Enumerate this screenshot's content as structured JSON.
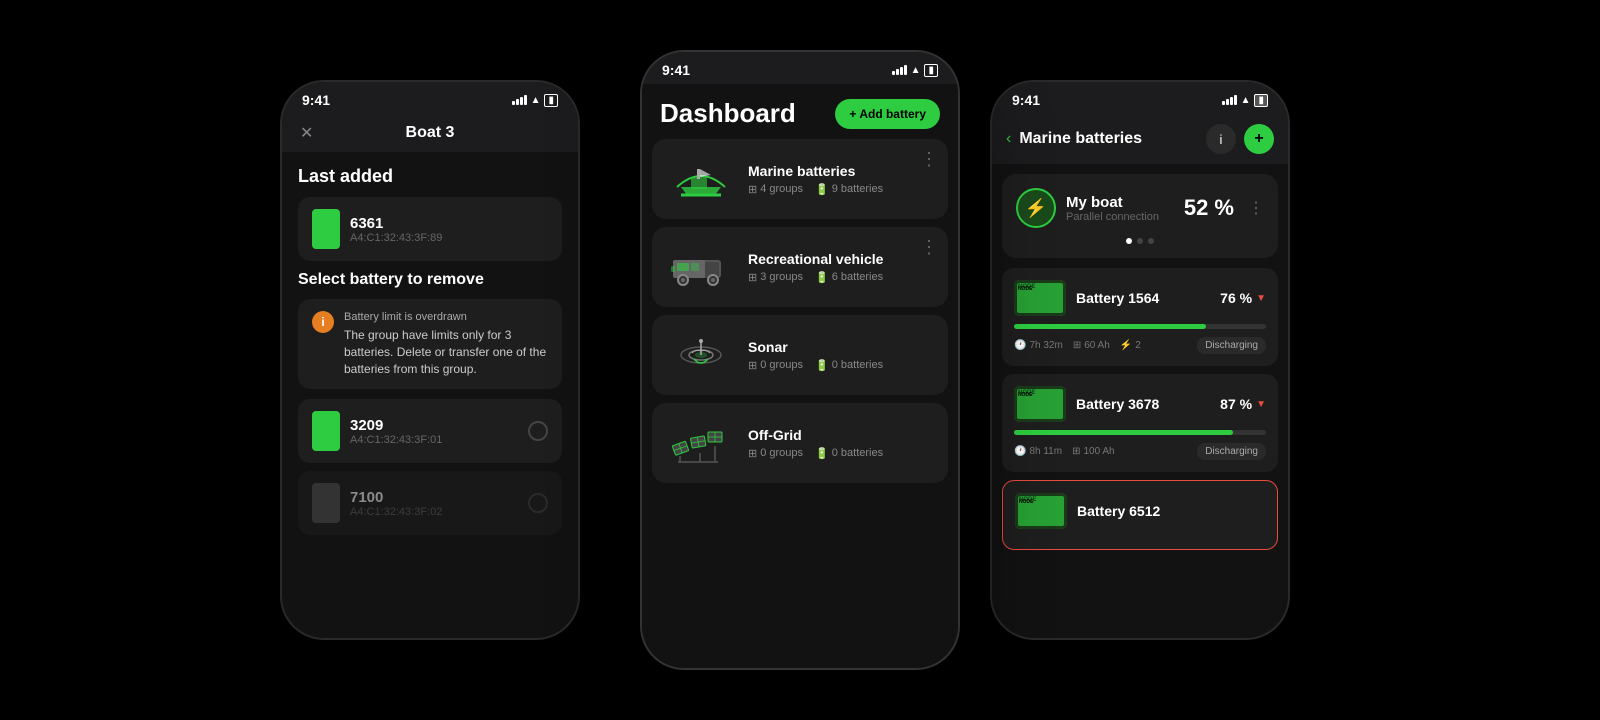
{
  "center_phone": {
    "status_time": "9:41",
    "title": "Dashboard",
    "add_button": "+ Add battery",
    "cards": [
      {
        "id": "marine",
        "title": "Marine batteries",
        "groups": "4 groups",
        "batteries": "9 batteries",
        "icon": "boat"
      },
      {
        "id": "rv",
        "title": "Recreational vehicle",
        "groups": "3 groups",
        "batteries": "6 batteries",
        "icon": "rv"
      },
      {
        "id": "sonar",
        "title": "Sonar",
        "groups": "0 groups",
        "batteries": "0 batteries",
        "icon": "sonar"
      },
      {
        "id": "offgrid",
        "title": "Off-Grid",
        "groups": "0 groups",
        "batteries": "0 batteries",
        "icon": "offgrid"
      }
    ]
  },
  "left_phone": {
    "status_time": "9:41",
    "header_title": "Boat 3",
    "section_last_added": "Last added",
    "last_battery": {
      "name": "6361",
      "mac": "A4:C1:32:43:3F:89"
    },
    "section_select": "Select battery to remove",
    "warning_title": "Battery limit is overdrawn",
    "warning_body": "The group have limits only for 3 batteries. Delete or transfer one of the batteries from this group.",
    "batteries": [
      {
        "name": "3209",
        "mac": "A4:C1:32:43:3F:01"
      },
      {
        "name": "7100",
        "mac": "A4:C1:32:43:3F:02"
      }
    ]
  },
  "right_phone": {
    "status_time": "9:41",
    "header_title": "Marine batteries",
    "group_card": {
      "name": "My boat",
      "sub": "Parallel connection",
      "percent": "52 %"
    },
    "batteries": [
      {
        "name": "Battery 1564",
        "percent": "76 %",
        "time": "7h 32m",
        "capacity": "60 Ah",
        "cells": "2",
        "status": "Discharging",
        "fill": 76
      },
      {
        "name": "Battery 3678",
        "percent": "87 %",
        "time": "8h 11m",
        "capacity": "100 Ah",
        "cells": "",
        "status": "Discharging",
        "fill": 87
      },
      {
        "name": "Battery 6512",
        "percent": "",
        "time": "",
        "capacity": "",
        "cells": "",
        "status": "",
        "fill": 0,
        "alert": true
      }
    ]
  },
  "bottom_labels": {
    "offgrid": "Off Grid",
    "groups": "groups",
    "batteries": "batteries"
  }
}
